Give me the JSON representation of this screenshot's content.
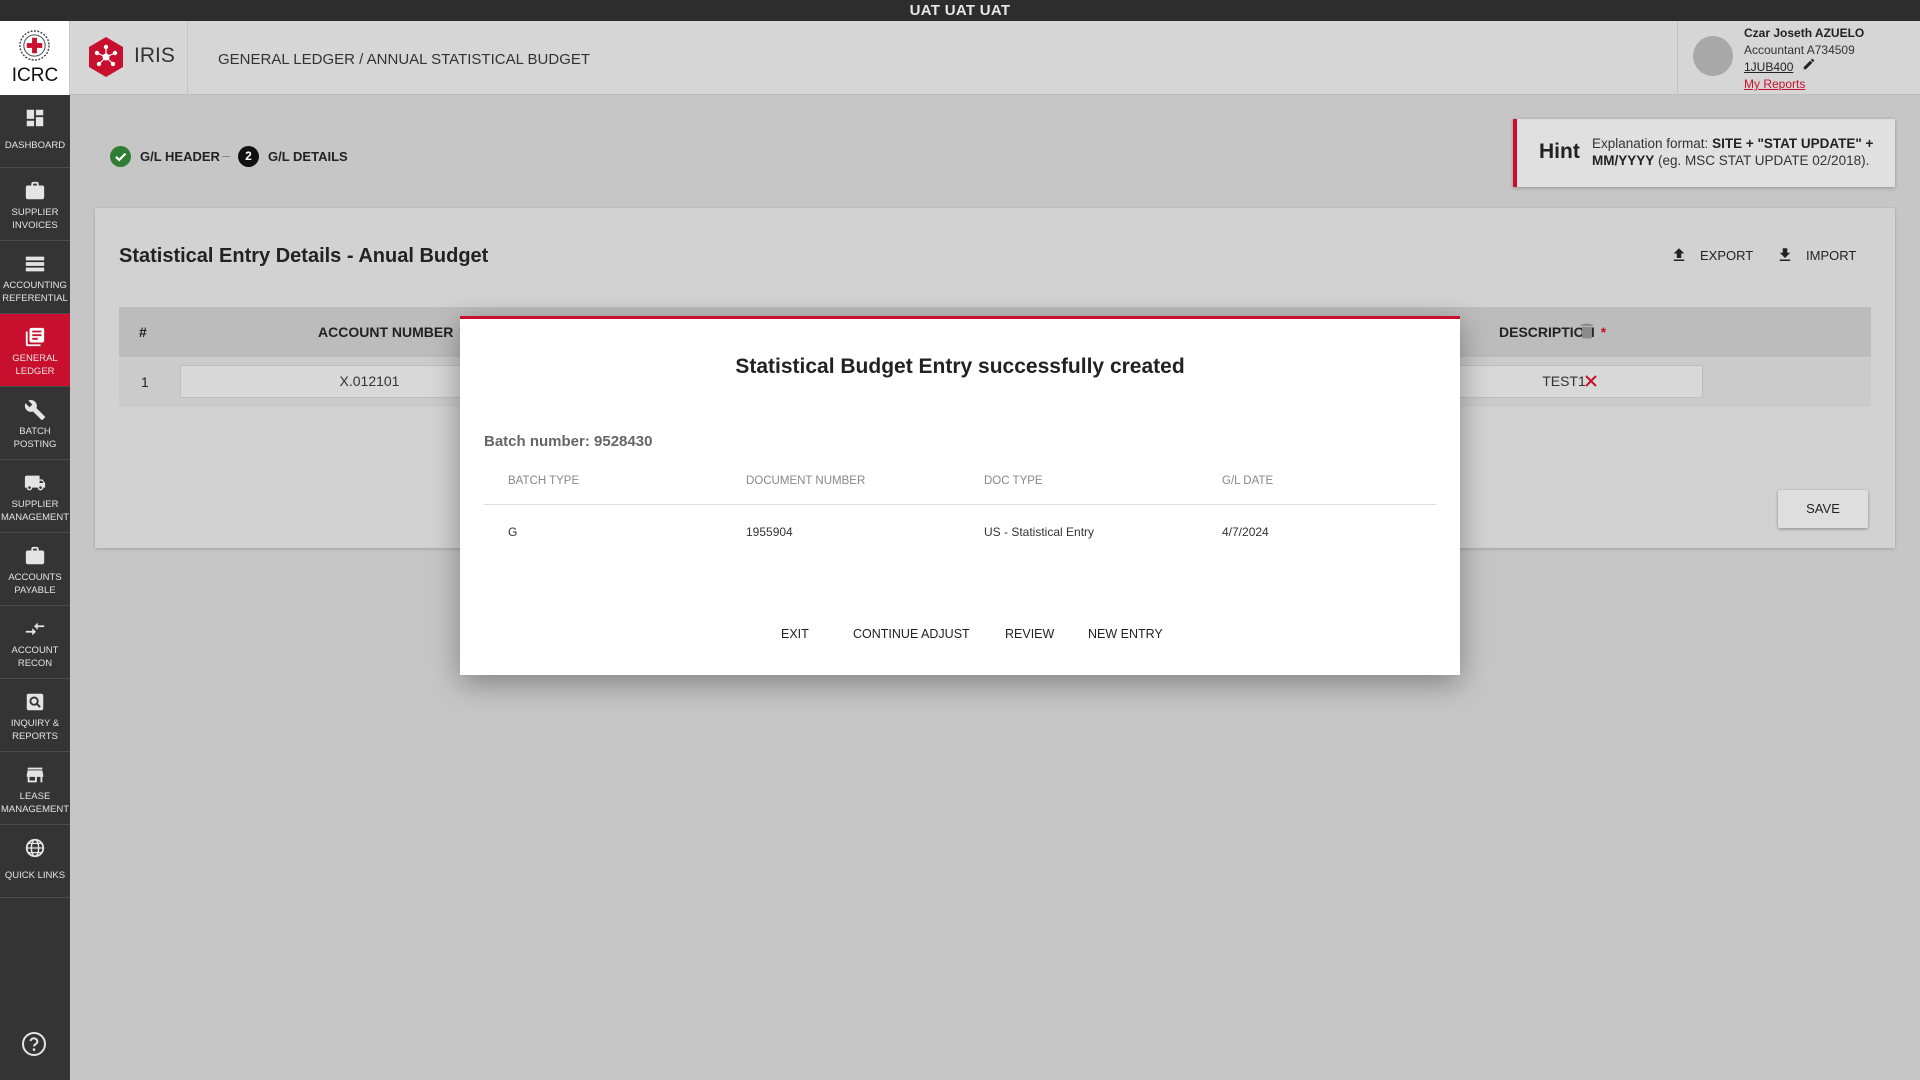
{
  "env_banner": "UAT UAT UAT",
  "brand": {
    "text": "ICRC",
    "emblem": "icrc-emblem",
    "accent": "#c8102e"
  },
  "app": {
    "name": "IRIS"
  },
  "breadcrumb": "GENERAL LEDGER / ANNUAL STATISTICAL BUDGET",
  "user": {
    "name": "Czar Joseth AZUELO",
    "role": "Accountant A734509",
    "code": "1JUB400",
    "reports_link": "My Reports"
  },
  "sidebar": {
    "items": [
      {
        "label": "Dashboard",
        "icon": "dashboard-icon"
      },
      {
        "label": "Supplier Invoices",
        "icon": "briefcase-icon"
      },
      {
        "label": "Accounting Referential",
        "icon": "list-icon"
      },
      {
        "label": "General Ledger",
        "icon": "ledger-icon",
        "active": true
      },
      {
        "label": "Batch Posting",
        "icon": "wrench-icon"
      },
      {
        "label": "Supplier Management",
        "icon": "truck-icon"
      },
      {
        "label": "Accounts Payable",
        "icon": "briefcase-icon"
      },
      {
        "label": "Account Recon",
        "icon": "compare-arrows-icon"
      },
      {
        "label": "Inquiry & Reports",
        "icon": "search-icon"
      },
      {
        "label": "Lease Management",
        "icon": "store-icon"
      },
      {
        "label": "Quick Links",
        "icon": "globe-icon"
      }
    ],
    "help_icon": "help-icon"
  },
  "stepper": {
    "steps": [
      {
        "label": "G/L HEADER",
        "status": "done"
      },
      {
        "number": "2",
        "label": "G/L DETAILS",
        "status": "current"
      }
    ]
  },
  "hint": {
    "title": "Hint",
    "text_prefix": "Explanation format: ",
    "text_bold": "SITE + \"STAT UPDATE\" + MM/YYYY",
    "text_suffix": " (eg. MSC STAT UPDATE 02/2018)."
  },
  "card": {
    "title": "Statistical Entry Details - Anual Budget",
    "export_label": "EXPORT",
    "import_label": "IMPORT",
    "save_label": "SAVE",
    "table": {
      "headers": {
        "num": "#",
        "account_number": "ACCOUNT NUMBER",
        "description": "DESCRIPTION"
      },
      "required_mark": "*",
      "rows": [
        {
          "num": "1",
          "account_number": "X.012101",
          "description": "TEST1"
        }
      ]
    }
  },
  "modal": {
    "title": "Statistical Budget Entry successfully created",
    "batch_number": "Batch number: 9528430",
    "columns": [
      "BATCH TYPE",
      "DOCUMENT NUMBER",
      "DOC TYPE",
      "G/L DATE"
    ],
    "row": {
      "batch_type": "G",
      "document_number": "1955904",
      "doc_type": "US - Statistical Entry",
      "gl_date": "4/7/2024"
    },
    "actions": {
      "exit": "EXIT",
      "continue_adjust": "CONTINUE ADJUST",
      "review": "REVIEW",
      "new_entry": "NEW ENTRY"
    }
  }
}
